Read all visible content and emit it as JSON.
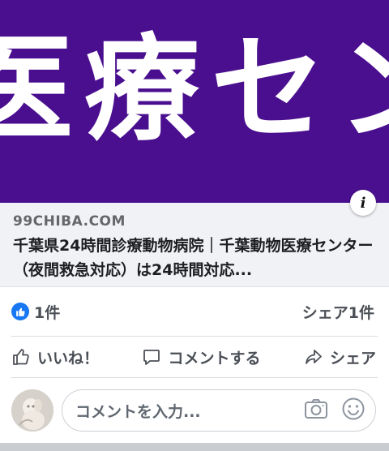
{
  "banner": {
    "text": "医療センタ",
    "background": "#4a0f8f"
  },
  "link": {
    "domain": "99CHIBA.COM",
    "title": "千葉県24時間診療動物病院｜千葉動物医療センター（夜間救急対応）は24時間対応..."
  },
  "stats": {
    "likes": "1件",
    "shares": "シェア1件"
  },
  "actions": {
    "like": "いいね！",
    "comment": "コメントする",
    "share": "シェア"
  },
  "composer": {
    "placeholder": "コメントを入力..."
  },
  "colors": {
    "accent": "#1877f2",
    "text_secondary": "#4b4f56"
  }
}
